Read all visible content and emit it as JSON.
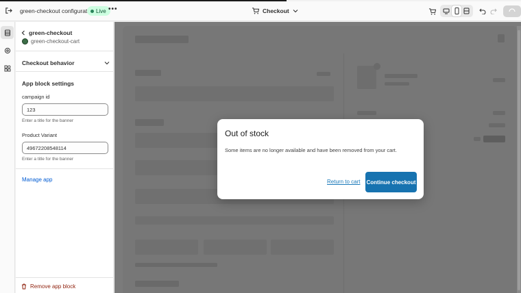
{
  "topbar": {
    "app_title": "green-checkout configuration",
    "status_badge": "Live",
    "more_label": "•••",
    "page_selector": "Checkout"
  },
  "panel": {
    "back_title": "green-checkout",
    "extension_name": "green-checkout-cart",
    "section_title": "Checkout behavior",
    "settings_heading": "App block settings",
    "fields": [
      {
        "label": "campaign id",
        "value": "123",
        "help": "Enter a title for the banner"
      },
      {
        "label": "Product Variant",
        "value": "49672208548114",
        "help": "Enter a title for the banner"
      }
    ],
    "manage_link": "Manage app",
    "remove_label": "Remove app block"
  },
  "modal": {
    "title": "Out of stock",
    "message": "Some items are no longer available and have been removed from your cart.",
    "secondary_link": "Return to cart",
    "primary_button": "Continue checkout"
  }
}
